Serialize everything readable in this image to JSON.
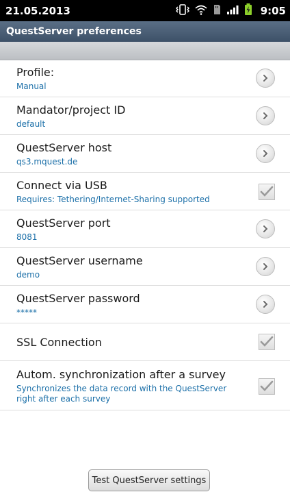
{
  "status_bar": {
    "date": "21.05.2013",
    "time": "9:05",
    "icons": [
      "vibrate-icon",
      "wifi-icon",
      "sd-card-icon",
      "signal-icon",
      "battery-charging-icon"
    ]
  },
  "title_bar": {
    "title": "QuestServer preferences"
  },
  "settings": {
    "items": [
      {
        "title": "Profile:",
        "summary": "Manual",
        "control": "chevron"
      },
      {
        "title": "Mandator/project ID",
        "summary": "default",
        "control": "chevron"
      },
      {
        "title": "QuestServer host",
        "summary": "qs3.mquest.de",
        "control": "chevron"
      },
      {
        "title": "Connect via USB",
        "summary": "Requires: Tethering/Internet-Sharing supported",
        "control": "checkbox"
      },
      {
        "title": "QuestServer port",
        "summary": "8081",
        "control": "chevron"
      },
      {
        "title": "QuestServer username",
        "summary": "demo",
        "control": "chevron"
      },
      {
        "title": "QuestServer password",
        "summary": "*****",
        "control": "chevron"
      },
      {
        "title": "SSL Connection",
        "summary": "",
        "control": "checkbox"
      },
      {
        "title": "Autom. synchronization after a survey",
        "summary": "Synchronizes the data record with the QuestServer right after each survey",
        "control": "checkbox"
      }
    ]
  },
  "footer": {
    "test_button_label": "Test QuestServer settings"
  },
  "colors": {
    "summary_text": "#1b6fa8",
    "title_bar": "#4a5e75"
  }
}
